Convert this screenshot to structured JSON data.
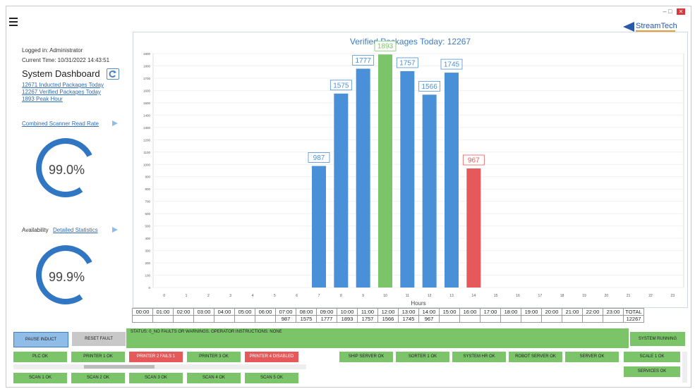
{
  "window": {
    "brand": "StreamTech"
  },
  "left": {
    "logged_in": "Logged in: Administrator",
    "current_time": "Current Time: 10/31/2022 14:43:51",
    "dashboard_title": "System Dashboard",
    "inducted": "12671 Inducted Packages Today",
    "verified": "12267 Verified Packages Today",
    "peak": "1893 Peak Hour",
    "scanner_label": "Combined Scanner Read Rate",
    "scanner_value": "99.0%",
    "availability_label": "Availability",
    "detailed_stats": "Detailed Statistics",
    "availability_value": "99.9%"
  },
  "chart_data": {
    "type": "bar",
    "title": "Verified Packages Today: 12267",
    "xlabel": "Hours",
    "categories": [
      "0",
      "1",
      "2",
      "3",
      "4",
      "5",
      "6",
      "7",
      "8",
      "9",
      "10",
      "11",
      "12",
      "13",
      "14",
      "15",
      "16",
      "17",
      "18",
      "19",
      "20",
      "21",
      "22",
      "23"
    ],
    "values": [
      null,
      null,
      null,
      null,
      null,
      null,
      null,
      987,
      1575,
      1777,
      1893,
      1757,
      1566,
      1745,
      967,
      null,
      null,
      null,
      null,
      null,
      null,
      null,
      null,
      null
    ],
    "colors": {
      "normal": "#4a90d9",
      "peak": "#7bc46a",
      "current": "#e5595a"
    },
    "peak_index": 10,
    "current_index": 14,
    "ylim": [
      0,
      1900
    ],
    "yticks": [
      0,
      100,
      200,
      300,
      400,
      500,
      600,
      700,
      800,
      900,
      1000,
      1100,
      1200,
      1300,
      1400,
      1500,
      1600,
      1700,
      1800,
      1900
    ]
  },
  "hour_table": {
    "headers": [
      "00:00",
      "01:00",
      "02:00",
      "03:00",
      "04:00",
      "05:00",
      "06:00",
      "07:00",
      "08:00",
      "09:00",
      "10:00",
      "11:00",
      "12:00",
      "13:00",
      "14:00",
      "15:00",
      "16:00",
      "17:00",
      "18:00",
      "19:00",
      "20:00",
      "21:00",
      "22:00",
      "23:00",
      "TOTAL"
    ],
    "values": [
      "",
      "",
      "",
      "",
      "",
      "",
      "",
      "987",
      "1575",
      "1777",
      "1893",
      "1757",
      "1566",
      "1745",
      "967",
      "",
      "",
      "",
      "",
      "",
      "",
      "",
      "",
      "",
      "12267"
    ]
  },
  "bottom": {
    "pause": "PAUSE INDUCT",
    "reset": "RESET FAULT",
    "status": "STATUS: 0_NO FAULTS OR WARNINGS. OPERATOR INSTRUCTIONS: NONE",
    "system_running": "SYSTEM RUNNING",
    "row1": [
      {
        "label": "PLC OK",
        "cls": "g"
      },
      {
        "label": "PRINTER 1 OK",
        "cls": "g"
      },
      {
        "label": "PRINTER 2 FAILS 1",
        "cls": "r"
      },
      {
        "label": "PRINTER 3 OK",
        "cls": "g"
      },
      {
        "label": "PRINTER 4 DISABLED",
        "cls": "r"
      }
    ],
    "row1b": [
      {
        "label": "SHIP SERVER OK",
        "cls": "g"
      },
      {
        "label": "SORTER 1 OK",
        "cls": "g"
      },
      {
        "label": "SYSTEM HR OK",
        "cls": "g"
      },
      {
        "label": "ROBOT SERVER OK",
        "cls": "g"
      },
      {
        "label": "SERVER OK",
        "cls": "g"
      }
    ],
    "scale": "SCALE 1 OK",
    "services": "SERVICES OK",
    "row2": [
      {
        "label": "SCAN 1 OK",
        "cls": "g"
      },
      {
        "label": "SCAN 2 OK",
        "cls": "g"
      },
      {
        "label": "SCAN 3 OK",
        "cls": "g"
      },
      {
        "label": "SCAN 4 OK",
        "cls": "g"
      },
      {
        "label": "SCAN 5 OK",
        "cls": "g"
      }
    ]
  }
}
